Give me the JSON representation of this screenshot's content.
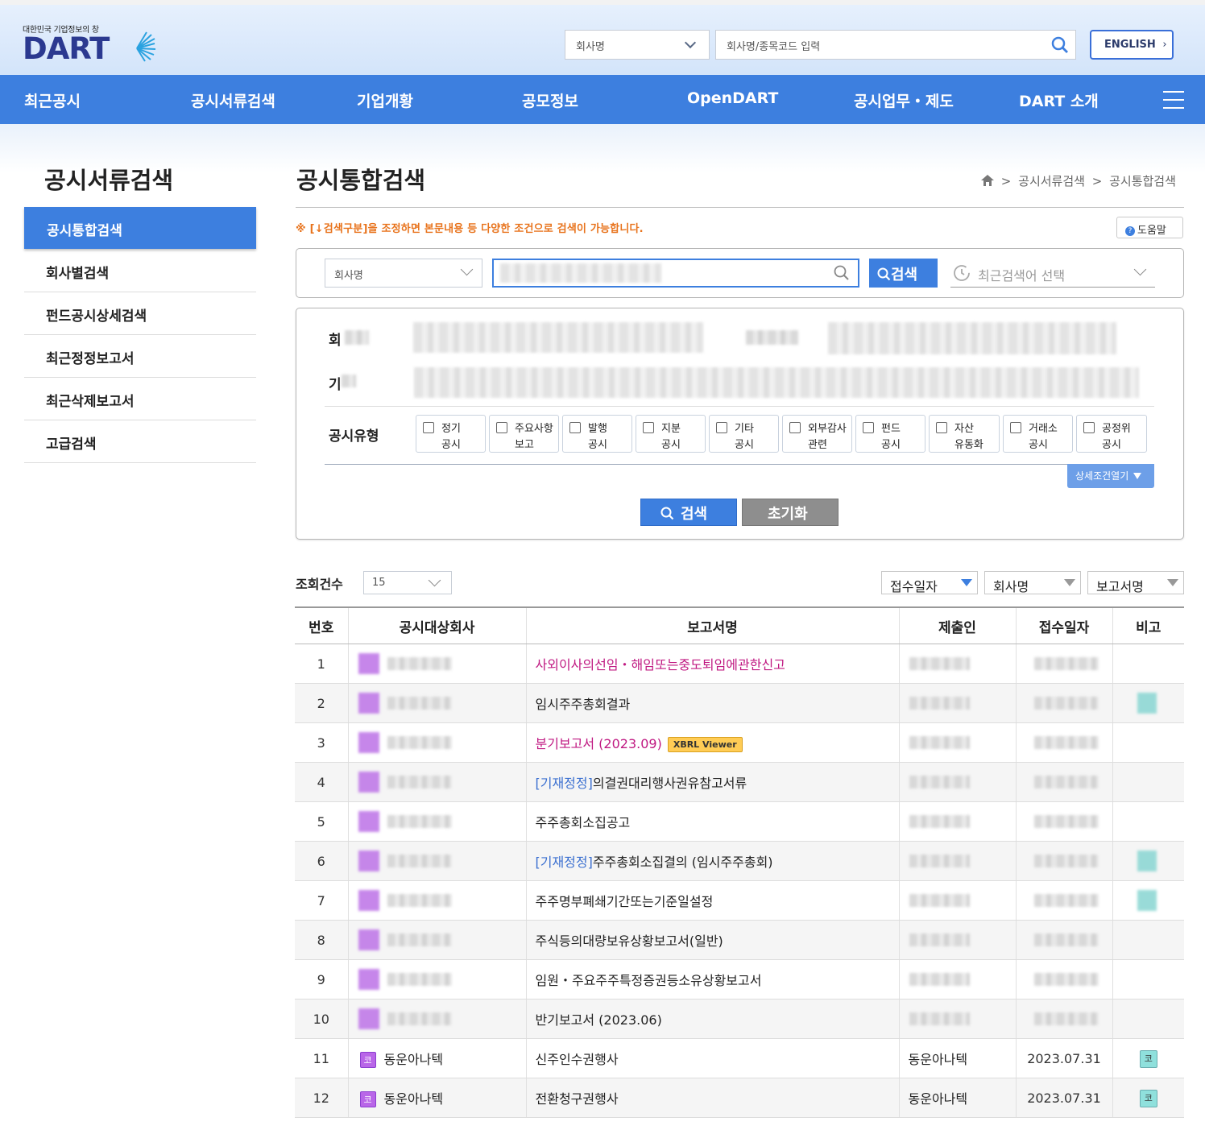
{
  "header": {
    "logo_sub": "대한민국 기업정보의 창",
    "logo_main": "DART",
    "search_type": "회사명",
    "search_placeholder": "회사명/종목코드 입력",
    "english_label": "ENGLISH"
  },
  "nav": {
    "items": [
      "최근공시",
      "공시서류검색",
      "기업개황",
      "공모정보",
      "OpenDART",
      "공시업무・제도",
      "DART 소개"
    ]
  },
  "sidebar": {
    "title": "공시서류검색",
    "items": [
      "공시통합검색",
      "회사별검색",
      "펀드공시상세검색",
      "최근정정보고서",
      "최근삭제보고서",
      "고급검색"
    ]
  },
  "main": {
    "title": "공시통합검색",
    "breadcrumb": [
      "공시서류검색",
      "공시통합검색"
    ],
    "notice": "※ [↓검색구분]을 조정하면 본문내용 등 다양한 조건으로 검색이 가능합니다.",
    "help_label": "도움말",
    "search_type": "회사명",
    "search_button": "검색",
    "recent_placeholder": "최근검색어 선택",
    "form": {
      "row1_label": "회",
      "row2_label": "기",
      "type_label": "공시유형",
      "types": [
        [
          "정기",
          "공시"
        ],
        [
          "주요사항",
          "보고"
        ],
        [
          "발행",
          "공시"
        ],
        [
          "지분",
          "공시"
        ],
        [
          "기타",
          "공시"
        ],
        [
          "외부감사",
          "관련"
        ],
        [
          "펀드",
          "공시"
        ],
        [
          "자산",
          "유동화"
        ],
        [
          "거래소",
          "공시"
        ],
        [
          "공정위",
          "공시"
        ]
      ],
      "detail_toggle": "상세조건열기",
      "search_btn": "검색",
      "reset_btn": "초기화"
    },
    "list": {
      "count_label": "조회건수",
      "count_value": "15",
      "sorts": [
        "접수일자",
        "회사명",
        "보고서명"
      ],
      "columns": [
        "번호",
        "공시대상회사",
        "보고서명",
        "제출인",
        "접수일자",
        "비고"
      ],
      "rows": [
        {
          "no": "1",
          "corp": "",
          "report": "사외이사의선임・해임또는중도퇴임에관한신고",
          "prefix": "",
          "style": "pink",
          "xbrl": "",
          "submitter": "",
          "date": "",
          "remark": ""
        },
        {
          "no": "2",
          "corp": "",
          "report": "임시주주총회결과",
          "prefix": "",
          "style": "",
          "xbrl": "",
          "submitter": "",
          "date": "",
          "remark": ""
        },
        {
          "no": "3",
          "corp": "",
          "report": "분기보고서 (2023.09)",
          "prefix": "",
          "style": "pink",
          "xbrl": "XBRL Viewer",
          "submitter": "",
          "date": "",
          "remark": ""
        },
        {
          "no": "4",
          "corp": "",
          "report": "의결권대리행사권유참고서류",
          "prefix": "[기재정정]",
          "style": "",
          "xbrl": "",
          "submitter": "",
          "date": "",
          "remark": ""
        },
        {
          "no": "5",
          "corp": "",
          "report": "주주총회소집공고",
          "prefix": "",
          "style": "",
          "xbrl": "",
          "submitter": "",
          "date": "",
          "remark": ""
        },
        {
          "no": "6",
          "corp": "",
          "report": "주주총회소집결의 (임시주주총회)",
          "prefix": "[기재정정]",
          "style": "",
          "xbrl": "",
          "submitter": "",
          "date": "",
          "remark": ""
        },
        {
          "no": "7",
          "corp": "",
          "report": "주주명부폐쇄기간또는기준일설정",
          "prefix": "",
          "style": "",
          "xbrl": "",
          "submitter": "",
          "date": "",
          "remark": ""
        },
        {
          "no": "8",
          "corp": "",
          "report": "주식등의대량보유상황보고서(일반)",
          "prefix": "",
          "style": "",
          "xbrl": "",
          "submitter": "",
          "date": "",
          "remark": ""
        },
        {
          "no": "9",
          "corp": "",
          "report": "임원・주요주주특정증권등소유상황보고서",
          "prefix": "",
          "style": "",
          "xbrl": "",
          "submitter": "",
          "date": "",
          "remark": ""
        },
        {
          "no": "10",
          "corp": "",
          "report": "반기보고서 (2023.06)",
          "prefix": "",
          "style": "",
          "xbrl": "",
          "submitter": "",
          "date": "",
          "remark": ""
        },
        {
          "no": "11",
          "corp": "동운아나텍",
          "report": "신주인수권행사",
          "prefix": "",
          "style": "",
          "xbrl": "",
          "submitter": "동운아나텍",
          "date": "2023.07.31",
          "remark": "코"
        },
        {
          "no": "12",
          "corp": "동운아나텍",
          "report": "전환청구권행사",
          "prefix": "",
          "style": "",
          "xbrl": "",
          "submitter": "동운아나텍",
          "date": "2023.07.31",
          "remark": "코"
        }
      ],
      "corp_badge": "코"
    }
  },
  "colors": {
    "brand_blue": "#3d7fdf",
    "logo_navy": "#2b3990",
    "notice_orange": "#e8731c",
    "report_pink": "#c01982",
    "badge_purple": "#b966e8",
    "badge_teal": "#8fe0dc"
  }
}
